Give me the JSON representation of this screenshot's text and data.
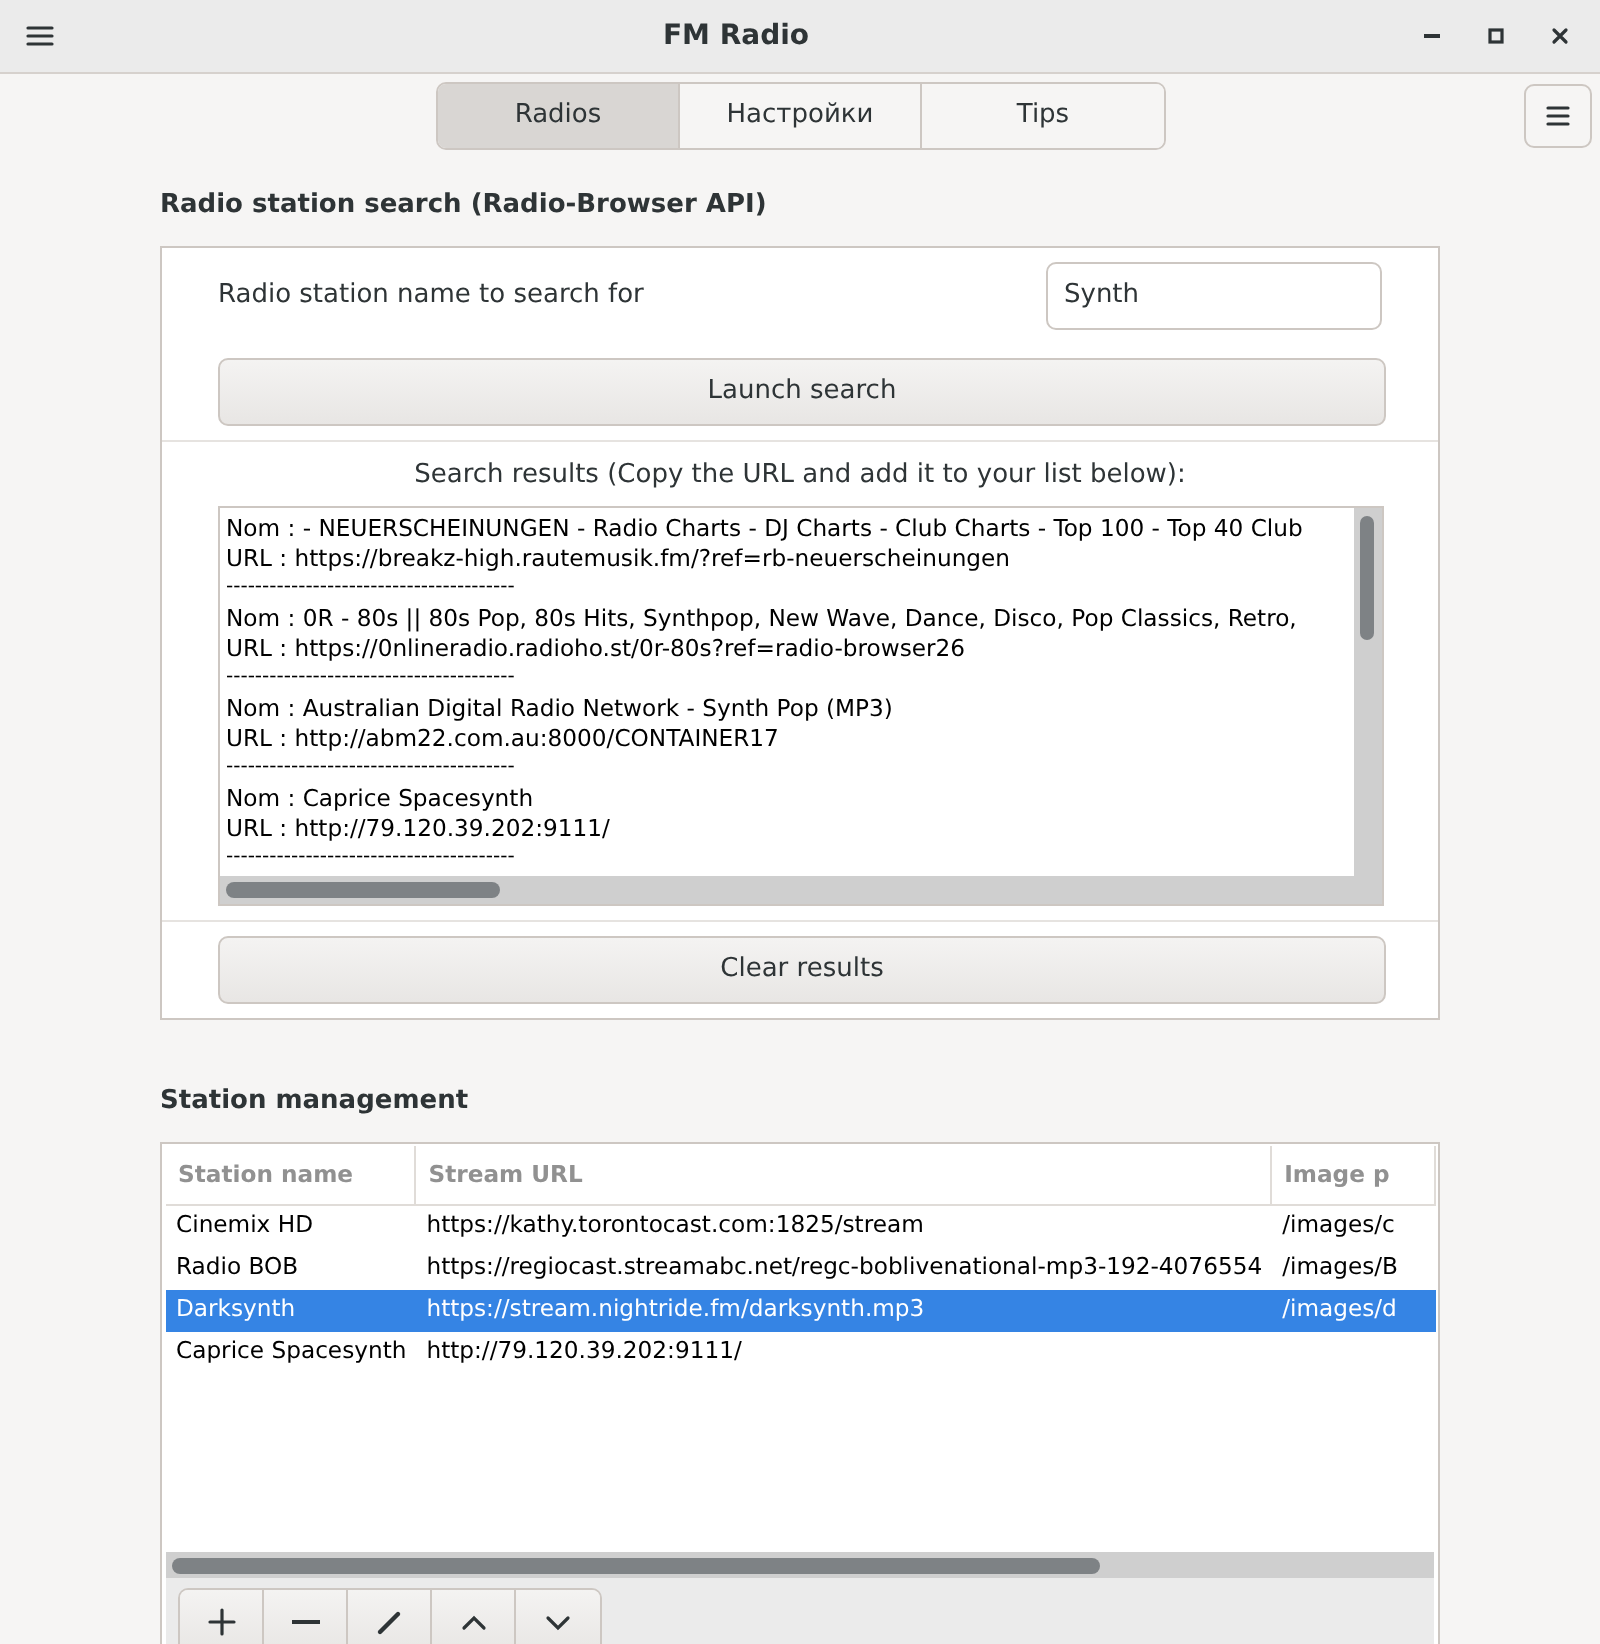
{
  "window": {
    "title": "FM Radio"
  },
  "tabs": [
    {
      "label": "Radios",
      "selected": true
    },
    {
      "label": "Настройки",
      "selected": false
    },
    {
      "label": "Tips",
      "selected": false
    }
  ],
  "search_section": {
    "heading": "Radio station search (Radio-Browser API)",
    "field_label": "Radio station name to search for",
    "search_value": "Synth",
    "launch_button": "Launch search",
    "results_label": "Search results (Copy the URL and add it to your list below):",
    "results": [
      {
        "name_line": "Nom : - NEUERSCHEINUNGEN - Radio Charts - DJ Charts - Club Charts - Top 100 - Top 40 Club",
        "url_line": "URL : https://breakz-high.rautemusik.fm/?ref=rb-neuerscheinungen",
        "separator": "----------------------------------------"
      },
      {
        "name_line": "Nom : 0R - 80s || 80s Pop, 80s Hits, Synthpop, New Wave, Dance, Disco, Pop Classics, Retro,",
        "url_line": "URL : https://0nlineradio.radioho.st/0r-80s?ref=radio-browser26",
        "separator": "----------------------------------------"
      },
      {
        "name_line": "Nom : Australian Digital Radio Network - Synth Pop (MP3)",
        "url_line": "URL : http://abm22.com.au:8000/CONTAINER17",
        "separator": "----------------------------------------"
      },
      {
        "name_line": "Nom : Caprice Spacesynth",
        "url_line": "URL : http://79.120.39.202:9111/",
        "separator": "----------------------------------------"
      }
    ],
    "clear_button": "Clear results"
  },
  "station_management": {
    "heading": "Station management",
    "columns": [
      "Station name",
      "Stream URL",
      "Image p"
    ],
    "rows": [
      {
        "cells": [
          "Cinemix HD",
          "https://kathy.torontocast.com:1825/stream",
          "/images/c"
        ],
        "selected": false
      },
      {
        "cells": [
          "Radio BOB",
          "https://regiocast.streamabc.net/regc-boblivenational-mp3-192-4076554",
          "/images/B"
        ],
        "selected": false
      },
      {
        "cells": [
          "Darksynth",
          "https://stream.nightride.fm/darksynth.mp3",
          "/images/d"
        ],
        "selected": true
      },
      {
        "cells": [
          "Caprice Spacesynth",
          "http://79.120.39.202:9111/",
          ""
        ],
        "selected": false
      }
    ],
    "toolbar": [
      {
        "kind": "add"
      },
      {
        "kind": "remove"
      },
      {
        "kind": "edit"
      },
      {
        "kind": "up"
      },
      {
        "kind": "down"
      }
    ]
  }
}
